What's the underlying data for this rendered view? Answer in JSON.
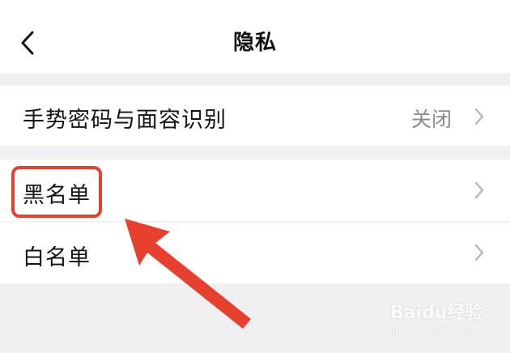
{
  "header": {
    "title": "隐私",
    "back_icon": "chevron-left-icon"
  },
  "settings": {
    "gesture_face": {
      "label": "手势密码与面容识别",
      "value": "关闭"
    },
    "blacklist": {
      "label": "黑名单"
    },
    "whitelist": {
      "label": "白名单"
    }
  },
  "annotation": {
    "highlight_color": "#e8402e",
    "arrow_color": "#e8402e"
  },
  "watermark": {
    "brand": "Baidu经验",
    "url": "jingyan.baidu.com"
  },
  "colors": {
    "background": "#f0f0f3",
    "row_bg": "#ffffff",
    "secondary_text": "#8a8a8f"
  }
}
